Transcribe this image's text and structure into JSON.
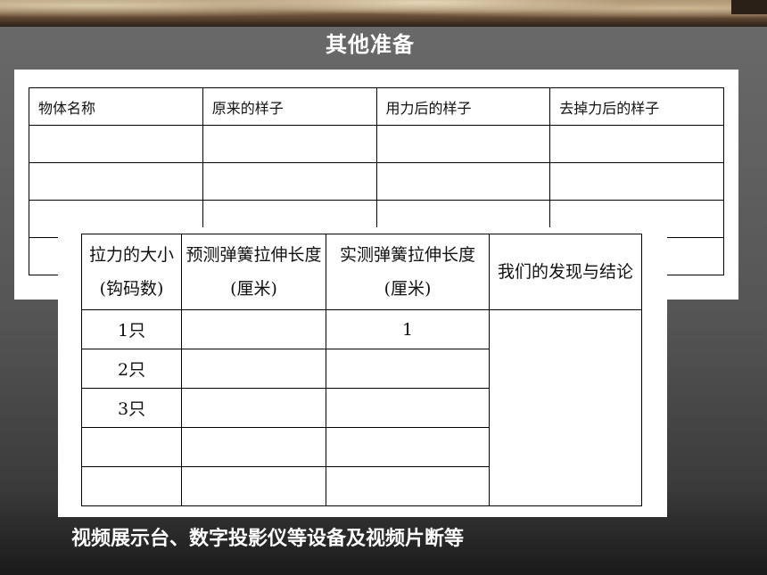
{
  "title": "其他准备",
  "table_back": {
    "headers": [
      "物体名称",
      "原来的样子",
      "用力后的样子",
      "去掉力后的样子"
    ]
  },
  "table_front": {
    "headers": [
      [
        "拉力的大小",
        "(钩码数)"
      ],
      [
        "预测弹簧拉伸长度",
        "(厘米)"
      ],
      [
        "实测弹簧拉伸长度",
        "(厘米)"
      ],
      [
        "我们的发现与结论"
      ]
    ],
    "rows": [
      [
        "1只",
        "",
        "1"
      ],
      [
        "2只",
        "",
        ""
      ],
      [
        "3只",
        "",
        ""
      ],
      [
        "",
        "",
        ""
      ],
      [
        "",
        "",
        ""
      ]
    ]
  },
  "footer": "视频展示台、数字投影仪等设备及视频片断等"
}
